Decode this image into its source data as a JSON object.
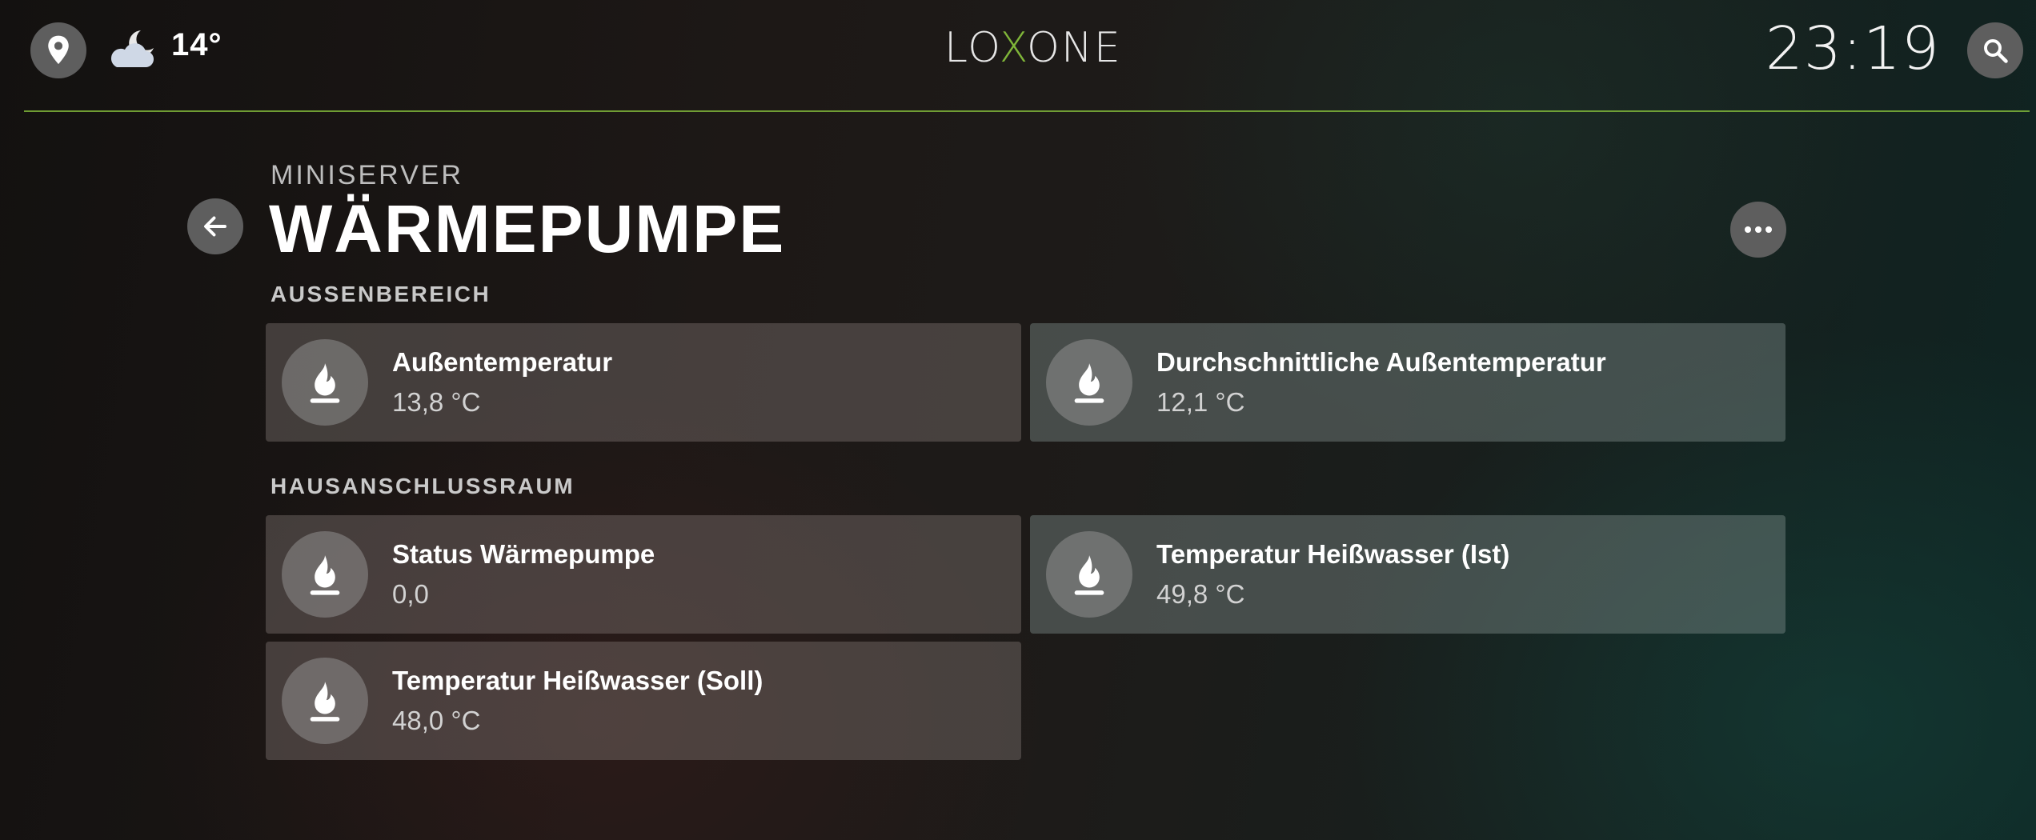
{
  "header": {
    "location_icon": "location-pin-icon",
    "weather_icon": "cloudy-night-moon-icon",
    "temperature": "14°",
    "logo": {
      "pre": "LO",
      "mark": "X",
      "post": "ONE"
    },
    "clock": "23:19",
    "search_icon": "search-icon",
    "accent_color": "#7fb539"
  },
  "page": {
    "subtitle": "MINISERVER",
    "title": "WÄRMEPUMPE",
    "back_icon": "arrow-left-icon",
    "more_icon": "more-dots-icon"
  },
  "sections": [
    {
      "label": "AUSSENBEREICH",
      "cards": [
        {
          "title": "Außentemperatur",
          "value": "13,8 °C",
          "icon": "flame-icon"
        },
        {
          "title": "Durchschnittliche Außentemperatur",
          "value": "12,1 °C",
          "icon": "flame-icon"
        }
      ]
    },
    {
      "label": "HAUSANSCHLUSSRAUM",
      "cards": [
        {
          "title": "Status Wärmepumpe",
          "value": "0,0",
          "icon": "flame-icon"
        },
        {
          "title": "Temperatur Heißwasser (Ist)",
          "value": "49,8 °C",
          "icon": "flame-icon"
        },
        {
          "title": "Temperatur Heißwasser (Soll)",
          "value": "48,0 °C",
          "icon": "flame-icon"
        }
      ]
    }
  ]
}
